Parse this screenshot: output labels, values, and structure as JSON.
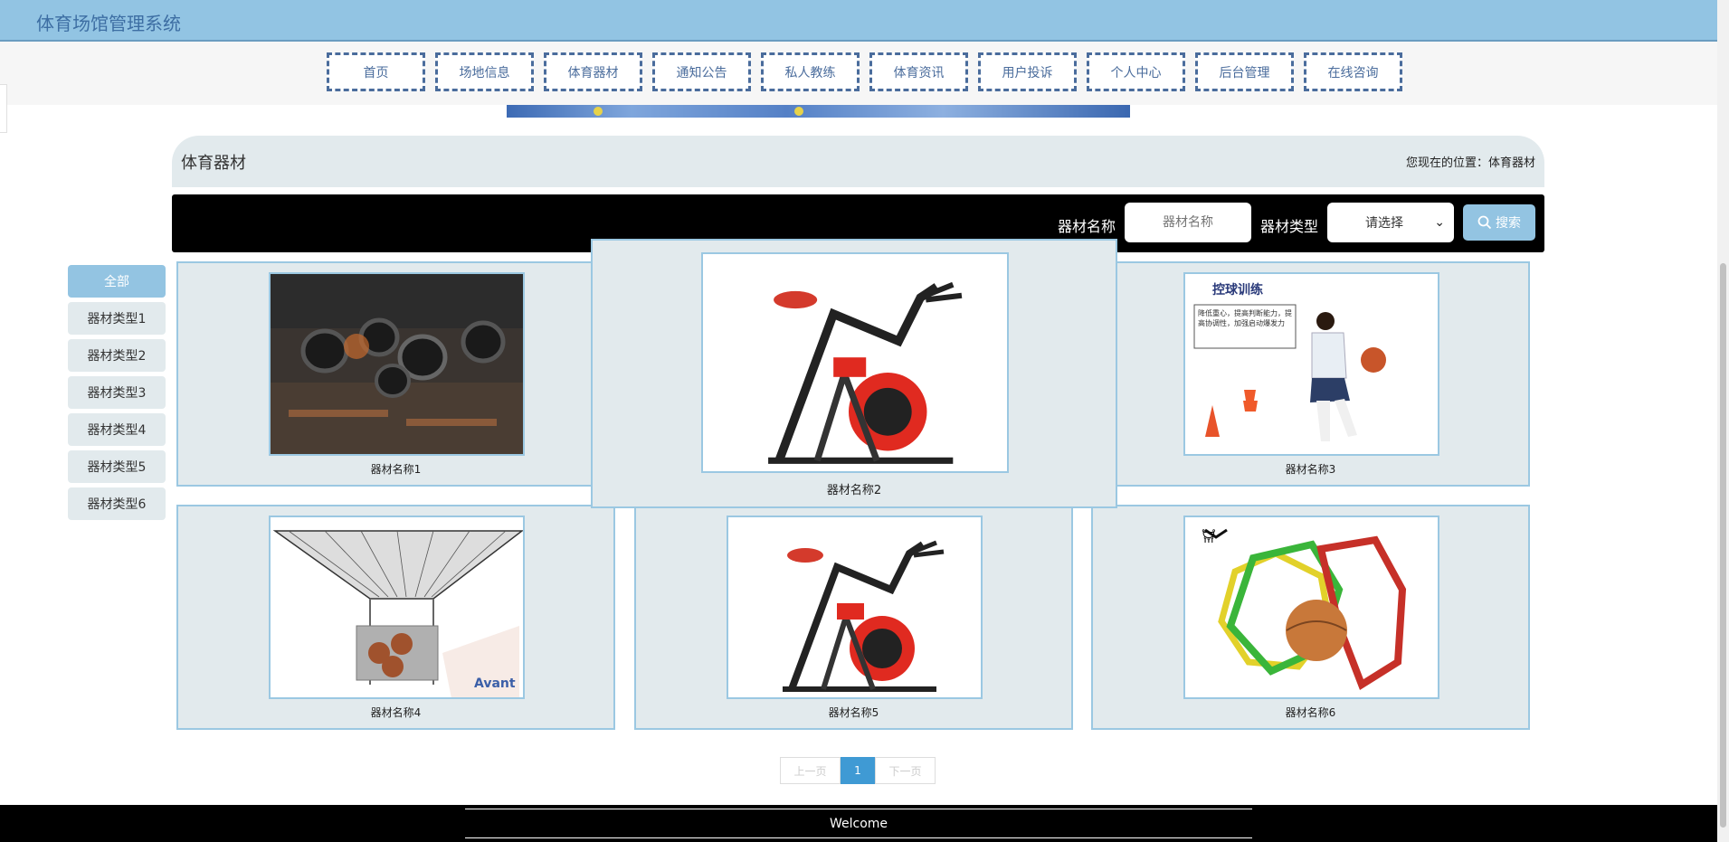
{
  "app": {
    "title": "体育场馆管理系统"
  },
  "nav": {
    "items": [
      {
        "label": "首页"
      },
      {
        "label": "场地信息"
      },
      {
        "label": "体育器材"
      },
      {
        "label": "通知公告"
      },
      {
        "label": "私人教练"
      },
      {
        "label": "体育资讯"
      },
      {
        "label": "用户投诉"
      },
      {
        "label": "个人中心"
      },
      {
        "label": "后台管理"
      },
      {
        "label": "在线咨询"
      }
    ]
  },
  "breadcrumb": {
    "title": "体育器材",
    "position": "您现在的位置：体育器材"
  },
  "search": {
    "name_label": "器材名称",
    "name_placeholder": "器材名称",
    "type_label": "器材类型",
    "type_selected": "请选择",
    "button_label": "搜索"
  },
  "categories": [
    {
      "label": "全部",
      "active": true
    },
    {
      "label": "器材类型1"
    },
    {
      "label": "器材类型2"
    },
    {
      "label": "器材类型3"
    },
    {
      "label": "器材类型4"
    },
    {
      "label": "器材类型5"
    },
    {
      "label": "器材类型6"
    }
  ],
  "items": [
    {
      "name": "器材名称1",
      "image": "gym-tires"
    },
    {
      "name": "器材名称2",
      "image": "spin-bike"
    },
    {
      "name": "器材名称3",
      "image": "ball-control-training"
    },
    {
      "name": "器材名称4",
      "image": "basketball-return-machine"
    },
    {
      "name": "器材名称5",
      "image": "spin-bike"
    },
    {
      "name": "器材名称6",
      "image": "agility-rings"
    }
  ],
  "image_text": {
    "ball_control_title": "控球训练",
    "ball_control_desc": "降低重心，提高判断能力，提高协调性，加强启动爆发力"
  },
  "pagination": {
    "prev": "上一页",
    "current": "1",
    "next": "下一页"
  },
  "footer": {
    "text": "Welcome"
  },
  "colors": {
    "header": "#92c4e3",
    "accent": "#93c4e2",
    "page_active": "#3f9ad4"
  }
}
